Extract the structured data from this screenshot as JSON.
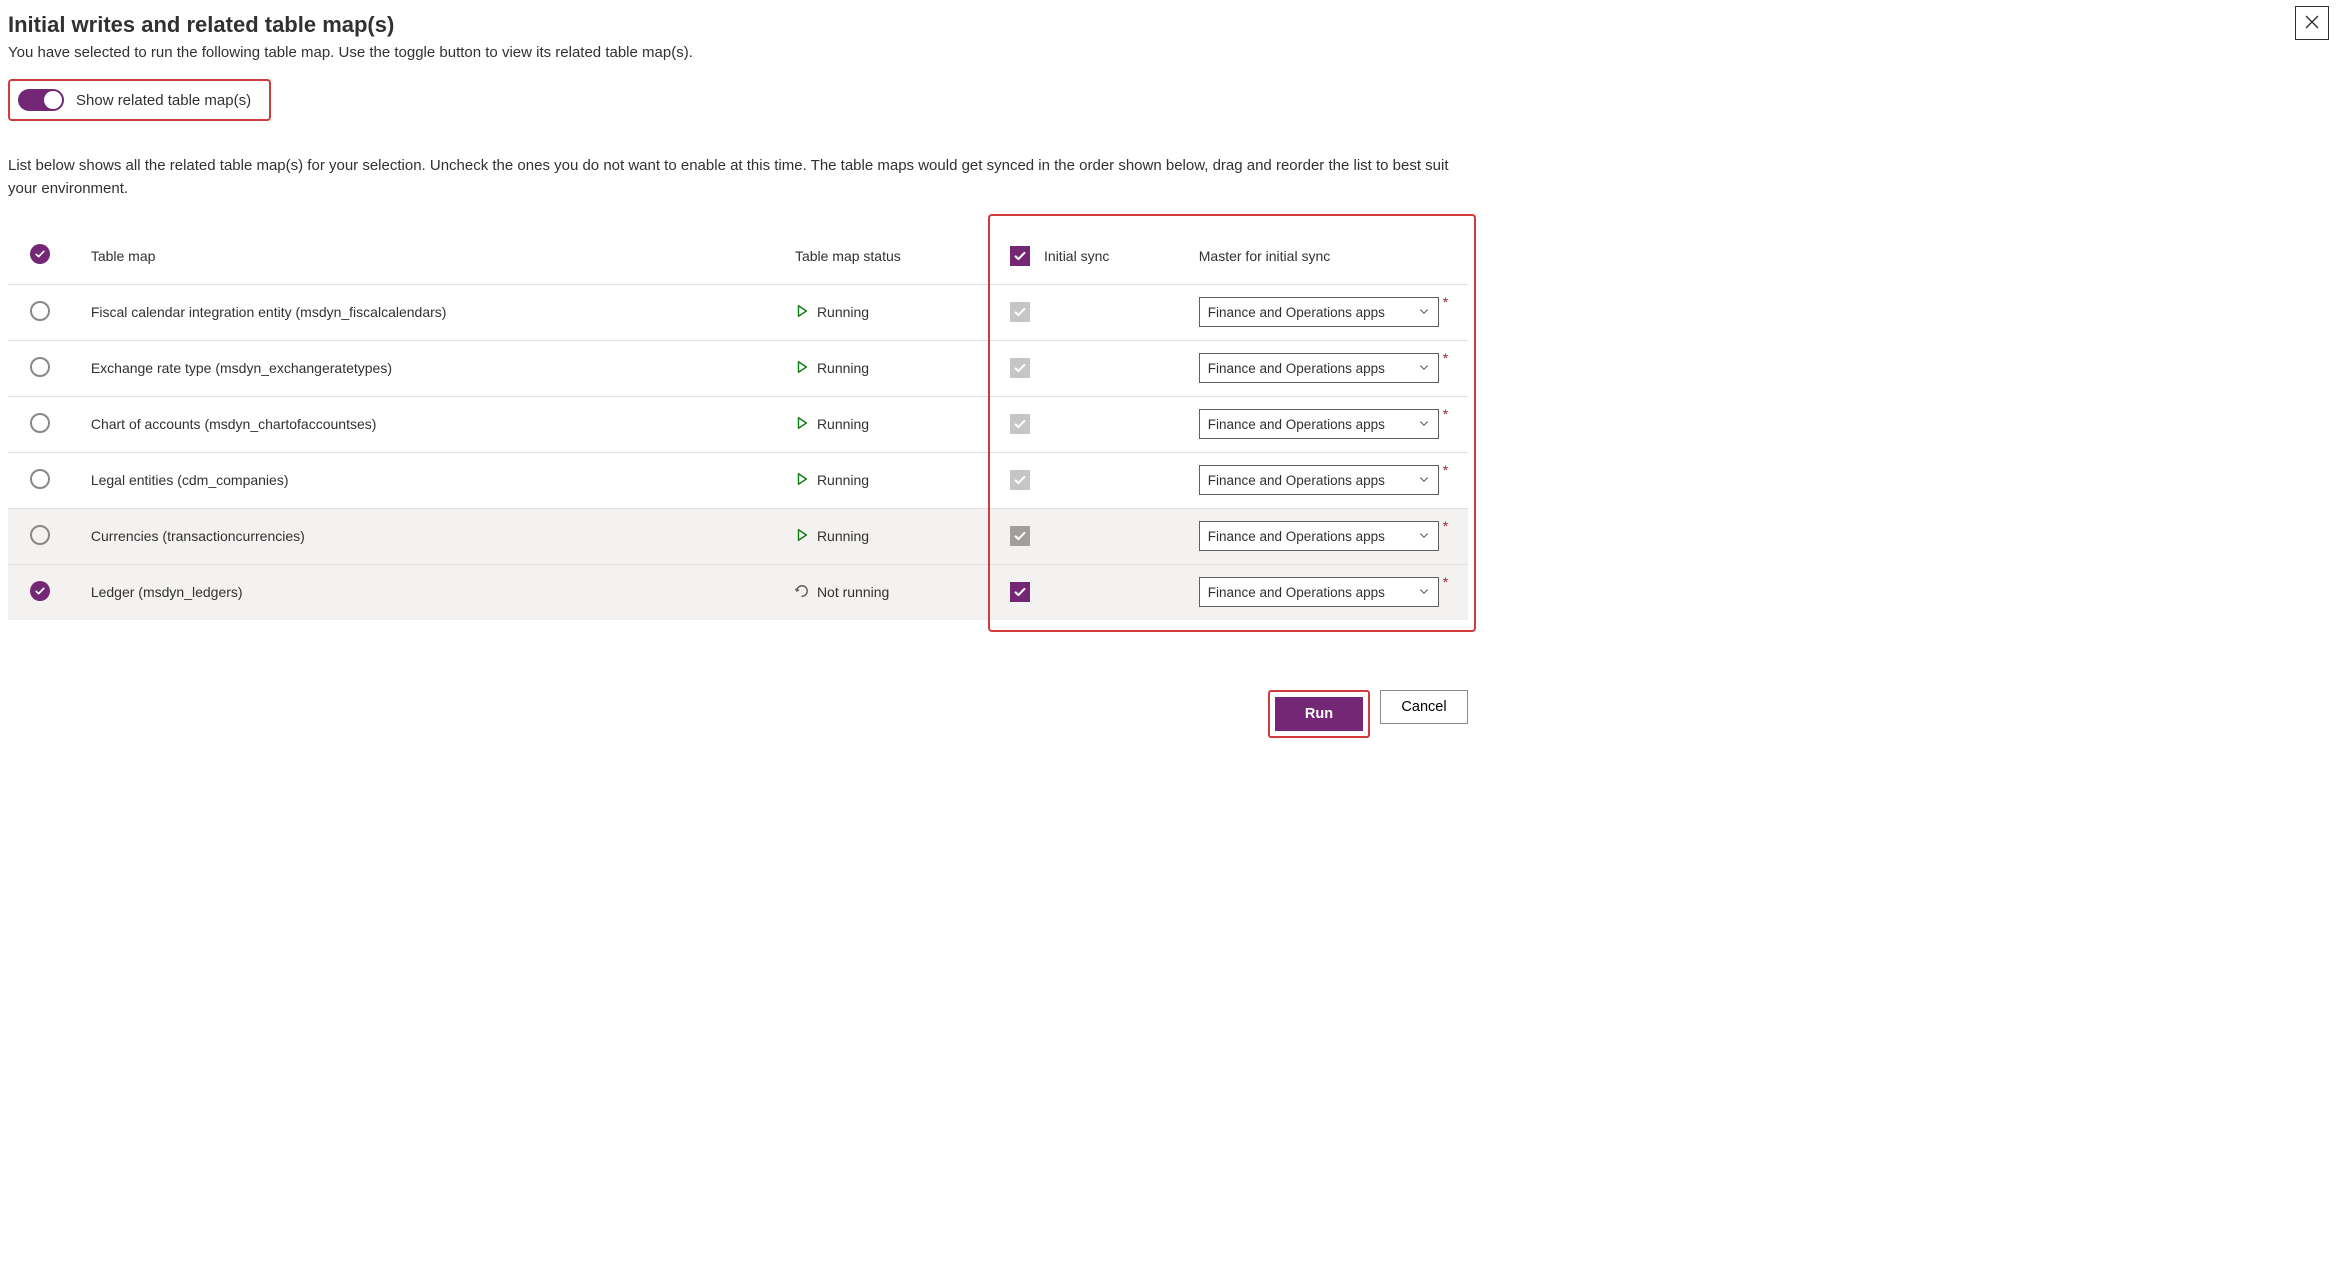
{
  "header": {
    "title": "Initial writes and related table map(s)",
    "subtitle": "You have selected to run the following table map. Use the toggle button to view its related table map(s)."
  },
  "toggle": {
    "label": "Show related table map(s)",
    "on": true
  },
  "list_description": "List below shows all the related table map(s) for your selection. Uncheck the ones you do not want to enable at this time. The table maps would get synced in the order shown below, drag and reorder the list to best suit your environment.",
  "columns": {
    "table_map": "Table map",
    "status": "Table map status",
    "initial_sync": "Initial sync",
    "master": "Master for initial sync"
  },
  "master_option": "Finance and Operations apps",
  "status_labels": {
    "running": "Running",
    "not_running": "Not running"
  },
  "rows": [
    {
      "selected": false,
      "name": "Fiscal calendar integration entity (msdyn_fiscalcalendars)",
      "status": "running",
      "sync_checked": true,
      "sync_active": false,
      "shaded": false
    },
    {
      "selected": false,
      "name": "Exchange rate type (msdyn_exchangeratetypes)",
      "status": "running",
      "sync_checked": true,
      "sync_active": false,
      "shaded": false
    },
    {
      "selected": false,
      "name": "Chart of accounts (msdyn_chartofaccountses)",
      "status": "running",
      "sync_checked": true,
      "sync_active": false,
      "shaded": false
    },
    {
      "selected": false,
      "name": "Legal entities (cdm_companies)",
      "status": "running",
      "sync_checked": true,
      "sync_active": false,
      "shaded": false
    },
    {
      "selected": false,
      "name": "Currencies (transactioncurrencies)",
      "status": "running",
      "sync_checked": true,
      "sync_active": false,
      "shaded": true
    },
    {
      "selected": true,
      "name": "Ledger (msdyn_ledgers)",
      "status": "not_running",
      "sync_checked": true,
      "sync_active": true,
      "shaded": true
    }
  ],
  "buttons": {
    "run": "Run",
    "cancel": "Cancel"
  }
}
